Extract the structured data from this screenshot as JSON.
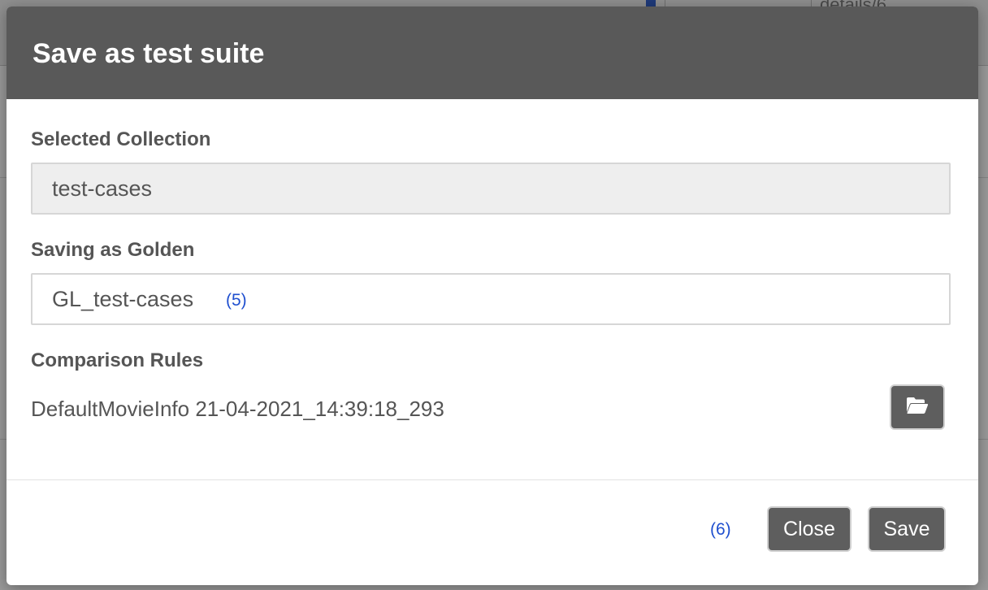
{
  "dialog": {
    "title": "Save as test suite",
    "selected_collection": {
      "label": "Selected Collection",
      "value": "test-cases"
    },
    "golden": {
      "label": "Saving as Golden",
      "value": "GL_test-cases",
      "annotation": "(5)"
    },
    "comparison_rules": {
      "label": "Comparison Rules",
      "value": "DefaultMovieInfo 21-04-2021_14:39:18_293",
      "browse_icon": "folder-open-icon"
    },
    "footer": {
      "annotation": "(6)",
      "close_label": "Close",
      "save_label": "Save"
    }
  },
  "background": {
    "tab_text": "details/6"
  },
  "colors": {
    "header_bg": "#595959",
    "button_bg": "#5e5e5e",
    "annotation": "#1f4fcf",
    "readonly_bg": "#eeeeee"
  }
}
